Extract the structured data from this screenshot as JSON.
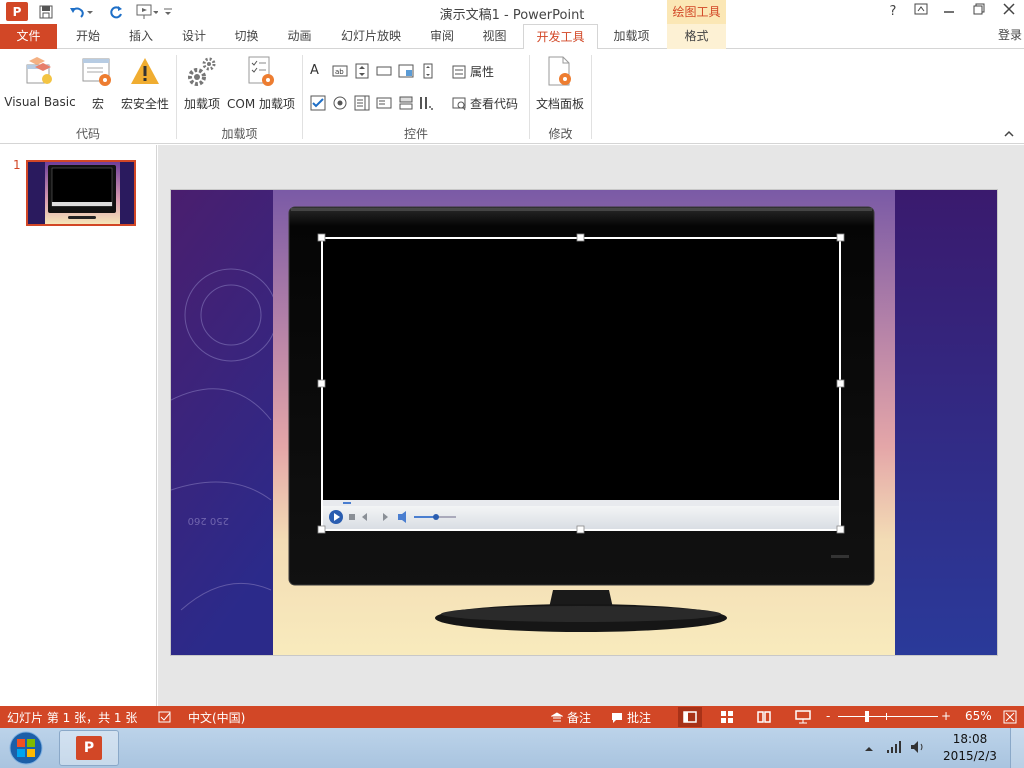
{
  "titlebar": {
    "app_badge": "P",
    "title": "演示文稿1 - PowerPoint",
    "context_header": "绘图工具",
    "help": "?",
    "window_controls": [
      "restore-ribbon",
      "minimize",
      "maximize",
      "close"
    ]
  },
  "tabs": [
    {
      "label": "文件",
      "kind": "file"
    },
    {
      "label": "开始"
    },
    {
      "label": "插入"
    },
    {
      "label": "设计"
    },
    {
      "label": "切换"
    },
    {
      "label": "动画"
    },
    {
      "label": "幻灯片放映"
    },
    {
      "label": "审阅"
    },
    {
      "label": "视图"
    },
    {
      "label": "开发工具",
      "active": true
    },
    {
      "label": "加载项"
    },
    {
      "label": "格式",
      "context": true
    }
  ],
  "login": "登录",
  "ribbon": {
    "code_group": {
      "label": "代码",
      "visual_basic": "Visual Basic",
      "macro": "宏",
      "macro_security": "宏安全性"
    },
    "addins_group": {
      "label": "加载项",
      "addins": "加载项",
      "com_addins": "COM 加载项"
    },
    "controls_group": {
      "label": "控件",
      "properties": "属性",
      "view_code": "查看代码"
    },
    "modify_group": {
      "label": "修改",
      "document_panel": "文档面板"
    }
  },
  "slides_pane": {
    "slide_number": "1"
  },
  "statusbar": {
    "slide_info": "幻灯片 第 1 张，共 1 张",
    "language": "中文(中国)",
    "notes": "备注",
    "comments": "批注",
    "zoom_minus": "-",
    "zoom_plus": "+",
    "zoom": "65%",
    "zoom_level": 0.65
  },
  "taskbar": {
    "time": "18:08",
    "date": "2015/2/3"
  },
  "colors": {
    "accent": "#d24726",
    "context_tab": "#fbe7b5",
    "slide_purple": "#3a1a6e",
    "slide_cream": "#f5e6b8"
  }
}
